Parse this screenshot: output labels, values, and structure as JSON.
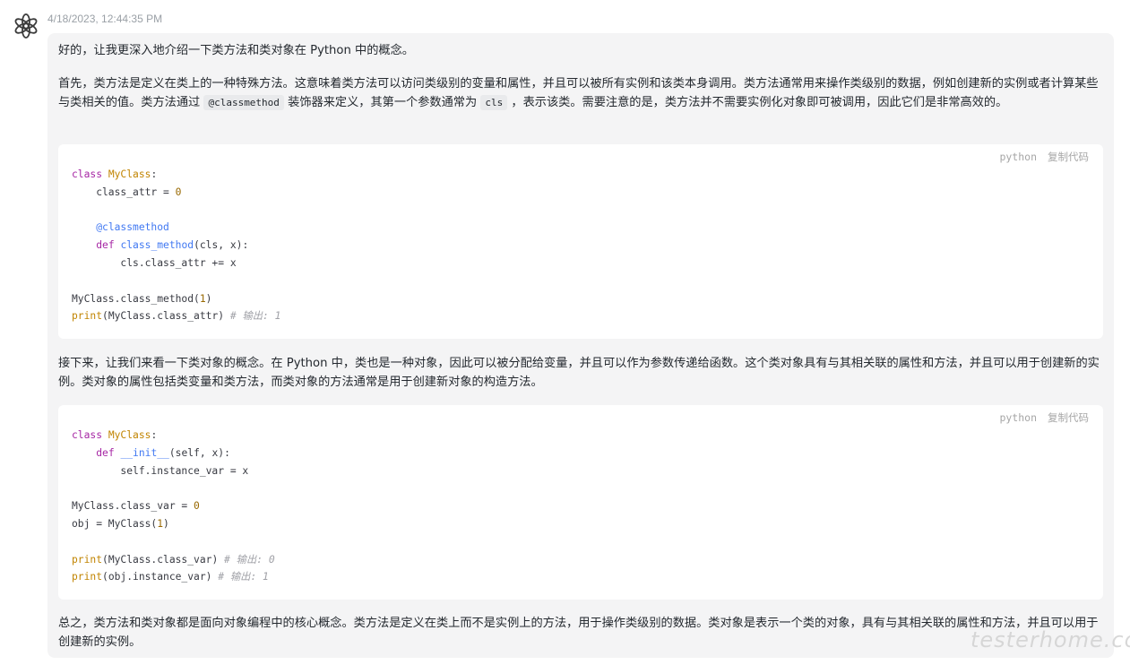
{
  "message": {
    "timestamp": "4/18/2023, 12:44:35 PM",
    "avatar_icon": "openai-logo-icon",
    "intro": "好的，让我更深入地介绍一下类方法和类对象在 Python 中的概念。",
    "p1_a": "首先，类方法是定义在类上的一种特殊方法。这意味着类方法可以访问类级别的变量和属性，并且可以被所有实例和该类本身调用。类方法通常用来操作类级别的数据，例如创建新的实例或者计算某些与类相关的值。类方法通过 ",
    "p1_code1": "@classmethod",
    "p1_b": " 装饰器来定义，其第一个参数通常为 ",
    "p1_code2": "cls",
    "p1_c": " ，表示该类。需要注意的是，类方法并不需要实例化对象即可被调用，因此它们是非常高效的。",
    "p2": "接下来，让我们来看一下类对象的概念。在 Python 中，类也是一种对象，因此可以被分配给变量，并且可以作为参数传递给函数。这个类对象具有与其相关联的属性和方法，并且可以用于创建新的实例。类对象的属性包括类变量和类方法，而类对象的方法通常是用于创建新对象的构造方法。",
    "p3": "总之，类方法和类对象都是面向对象编程中的核心概念。类方法是定义在类上而不是实例上的方法，用于操作类级别的数据。类对象是表示一个类的对象，具有与其相关联的属性和方法，并且可以用于创建新的实例。",
    "code_blocks": [
      {
        "lang": "python",
        "copy_label": "复制代码",
        "code": "class MyClass:\n    class_attr = 0\n\n    @classmethod\n    def class_method(cls, x):\n        cls.class_attr += x\n\nMyClass.class_method(1)\nprint(MyClass.class_attr) # 输出: 1"
      },
      {
        "lang": "python",
        "copy_label": "复制代码",
        "code": "class MyClass:\n    def __init__(self, x):\n        self.instance_var = x\n\nMyClass.class_var = 0\nobj = MyClass(1)\n\nprint(MyClass.class_var) # 输出: 0\nprint(obj.instance_var) # 输出: 1"
      }
    ]
  },
  "watermark": "testerhome.com"
}
